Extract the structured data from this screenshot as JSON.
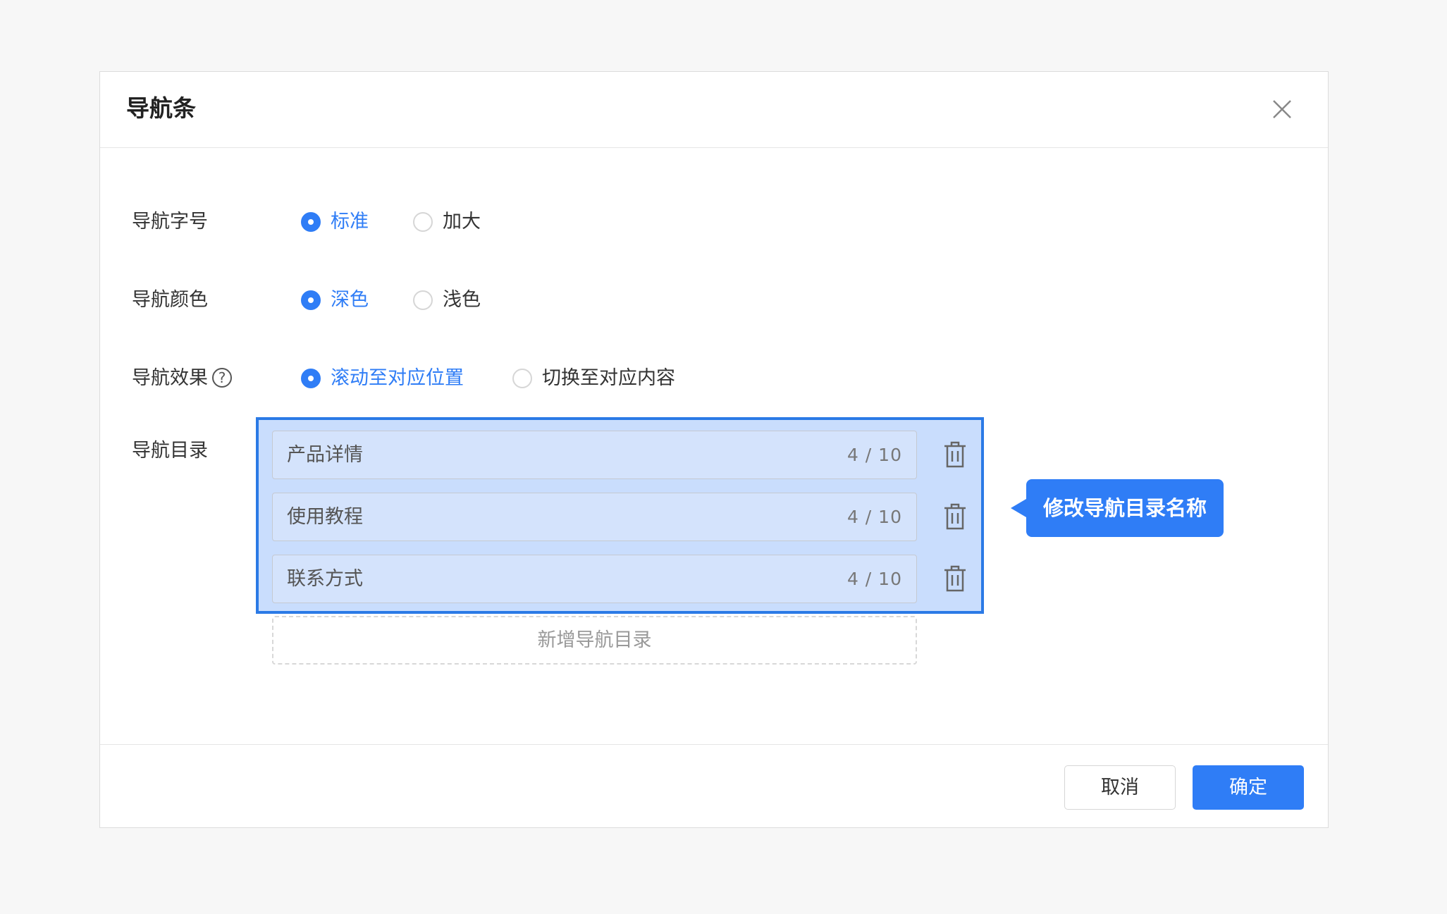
{
  "dialog": {
    "title": "导航条",
    "close_icon": "close-icon"
  },
  "form": {
    "font_size": {
      "label": "导航字号",
      "options": [
        {
          "label": "标准",
          "checked": true
        },
        {
          "label": "加大",
          "checked": false
        }
      ]
    },
    "color": {
      "label": "导航颜色",
      "options": [
        {
          "label": "深色",
          "checked": true
        },
        {
          "label": "浅色",
          "checked": false
        }
      ]
    },
    "effect": {
      "label": "导航效果",
      "help_icon": "question-circle-icon",
      "help_symbol": "?",
      "options": [
        {
          "label": "滚动至对应位置",
          "checked": true
        },
        {
          "label": "切换至对应内容",
          "checked": false
        }
      ]
    },
    "directory": {
      "label": "导航目录",
      "items": [
        {
          "value": "产品详情",
          "count": "4 / 10"
        },
        {
          "value": "使用教程",
          "count": "4 / 10"
        },
        {
          "value": "联系方式",
          "count": "4 / 10"
        }
      ],
      "add_label": "新增导航目录",
      "delete_icon": "trash-icon"
    }
  },
  "annotation": {
    "tooltip": "修改导航目录名称"
  },
  "footer": {
    "cancel_label": "取消",
    "ok_label": "确定"
  },
  "colors": {
    "primary": "#2f7df6",
    "highlight_border": "#2b7ae6",
    "page_background": "#f7f7f7"
  }
}
